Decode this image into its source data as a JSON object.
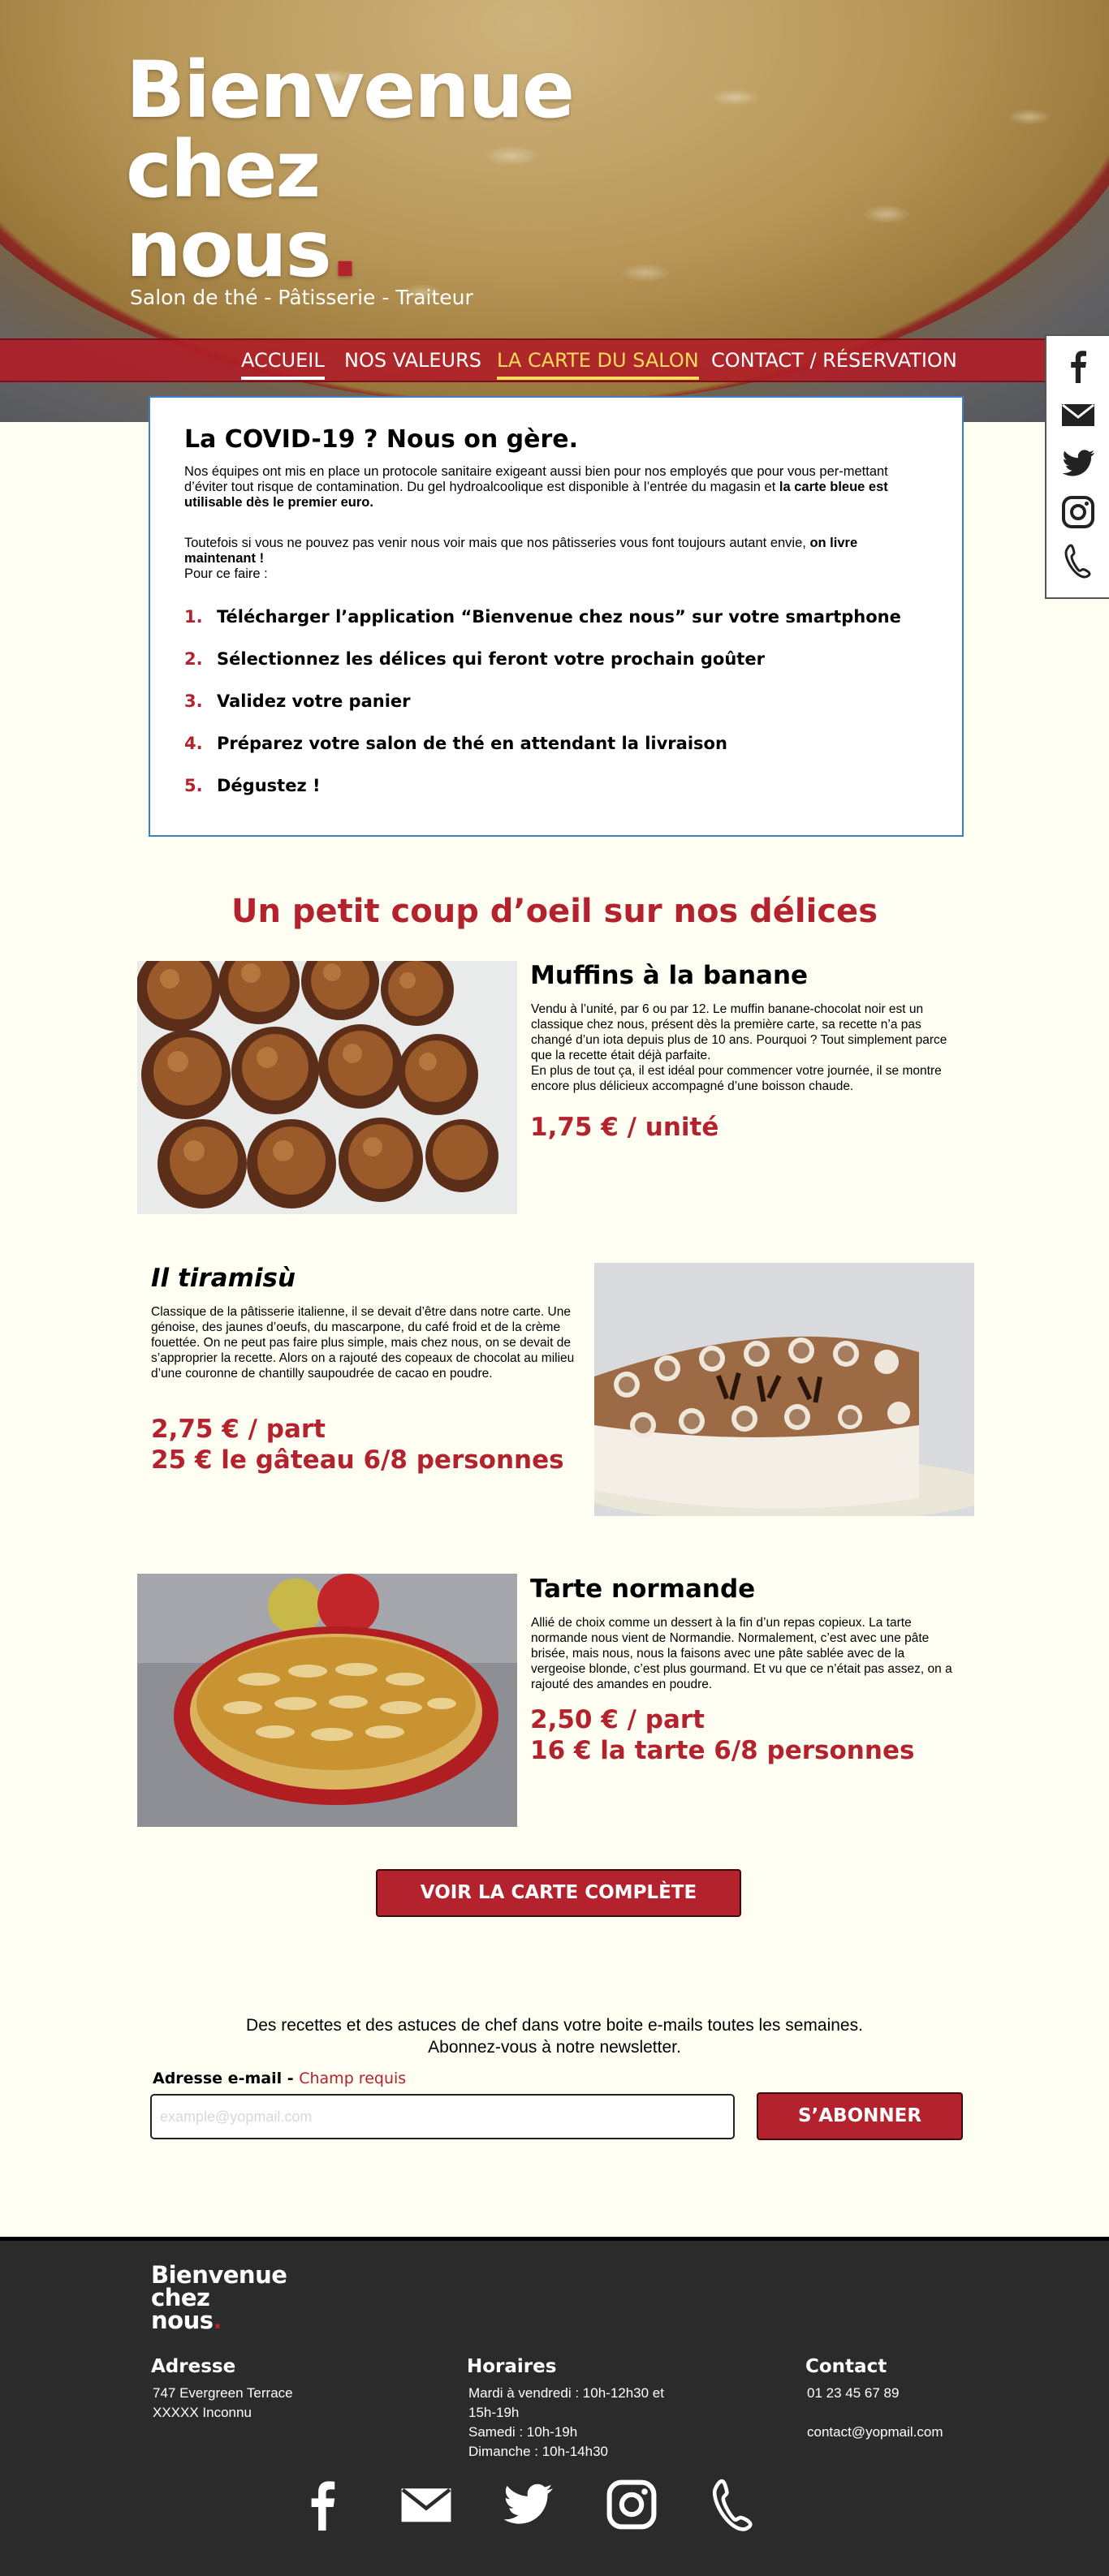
{
  "hero": {
    "title_line1": "Bienvenue",
    "title_line2": "chez",
    "title_line3": "nous",
    "title_dot": ".",
    "subtitle": "Salon de thé - Pâtisserie - Traiteur"
  },
  "nav": {
    "items": [
      "ACCUEIL",
      "NOS VALEURS",
      "LA CARTE DU SALON",
      "CONTACT / RÉSERVATION"
    ]
  },
  "social_icons": [
    "facebook-icon",
    "mail-icon",
    "twitter-icon",
    "instagram-icon",
    "phone-icon"
  ],
  "covid": {
    "title": "La COVID-19 ? Nous on gère.",
    "p1_a": "Nos équipes ont mis en place un protocole sanitaire exigeant aussi bien pour nos employés que pour vous per-mettant d’éviter tout risque de contamination. Du gel hydroalcoolique est disponible à l’entrée du magasin et ",
    "p1_b": "la carte bleue est utilisable dès le premier euro.",
    "p2_a": "Toutefois si vous ne pouvez pas venir nous voir mais que nos pâtisseries vous font toujours autant envie, ",
    "p2_b": "on livre maintenant !",
    "p2_c": "Pour ce faire :",
    "steps": [
      {
        "num": "1.",
        "text": "Télécharger l’application “Bienvenue chez nous” sur votre smartphone"
      },
      {
        "num": "2.",
        "text": "Sélectionnez les délices qui feront votre prochain goûter"
      },
      {
        "num": "3.",
        "text": "Validez votre panier"
      },
      {
        "num": "4.",
        "text": "Préparez votre salon de thé en attendant la livraison"
      },
      {
        "num": "5.",
        "text": "Dégustez !"
      }
    ]
  },
  "products_title": "Un petit coup d’oeil sur nos délices",
  "products": [
    {
      "name": "Muffins à la banane",
      "desc": "Vendu à l’unité, par 6 ou par 12. Le muffin banane-chocolat noir est un classique chez nous, présent dès la première carte, sa recette n’a pas changé d’un iota depuis plus de 10 ans. Pourquoi ? Tout simplement parce que la recette était déjà parfaite.\nEn plus de tout ça, il est idéal pour commencer votre journée, il se montre encore plus délicieux accompagné d’une boisson chaude.",
      "price1": "1,75 € / unité",
      "price2": ""
    },
    {
      "name": "Il tiramisù",
      "desc": "Classique de la pâtisserie italienne, il se devait d’être dans notre carte. Une génoise, des jaunes d’oeufs, du mascarpone, du café froid et de la crème fouettée. On ne peut pas faire plus simple, mais chez nous, on se devait de s’approprier la recette. Alors on a rajouté des copeaux de chocolat au milieu d’une couronne de chantilly saupoudrée de cacao en poudre.",
      "price1": "2,75 € / part",
      "price2": "25 € le gâteau 6/8 personnes"
    },
    {
      "name": "Tarte normande",
      "desc": "Allié de choix comme un dessert à la fin d’un repas copieux. La tarte normande nous vient de Normandie. Normalement, c’est avec une pâte brisée, mais nous, nous la faisons avec une pâte sablée avec de la vergeoise blonde, c’est plus gourmand. Et vu que ce n’était pas assez, on a rajouté des amandes en poudre.",
      "price1": "2,50 € / part",
      "price2": "16 € la tarte 6/8 personnes"
    }
  ],
  "cta_label": "VOIR LA CARTE COMPLÈTE",
  "newsletter": {
    "line1": "Des recettes et des astuces de chef dans votre boite e-mails toutes les semaines.",
    "line2": "Abonnez-vous à notre newsletter.",
    "label": "Adresse e-mail",
    "label_sep": " - ",
    "required": "Champ requis",
    "placeholder": "example@yopmail.com",
    "button": "S’ABONNER"
  },
  "footer": {
    "logo_line1": "Bienvenue",
    "logo_line2": "chez",
    "logo_line3": "nous",
    "logo_dot": ".",
    "address_title": "Adresse",
    "address_line1": "747 Evergreen Terrace",
    "address_line2": "XXXXX Inconnu",
    "hours_title": "Horaires",
    "hours_line1": "Mardi à vendredi : 10h-12h30 et",
    "hours_line2": "15h-19h",
    "hours_line3": "Samedi : 10h-19h",
    "hours_line4": "Dimanche : 10h-14h30",
    "contact_title": "Contact",
    "contact_phone": "01 23 45 67 89",
    "contact_email": "contact@yopmail.com"
  },
  "colors": {
    "accent": "#b3222d",
    "page_bg": "#fefef2",
    "footer_bg": "#2b2b2b",
    "nav_active_yellow": "#f6dc5c",
    "covid_border": "#3a7fc2"
  }
}
